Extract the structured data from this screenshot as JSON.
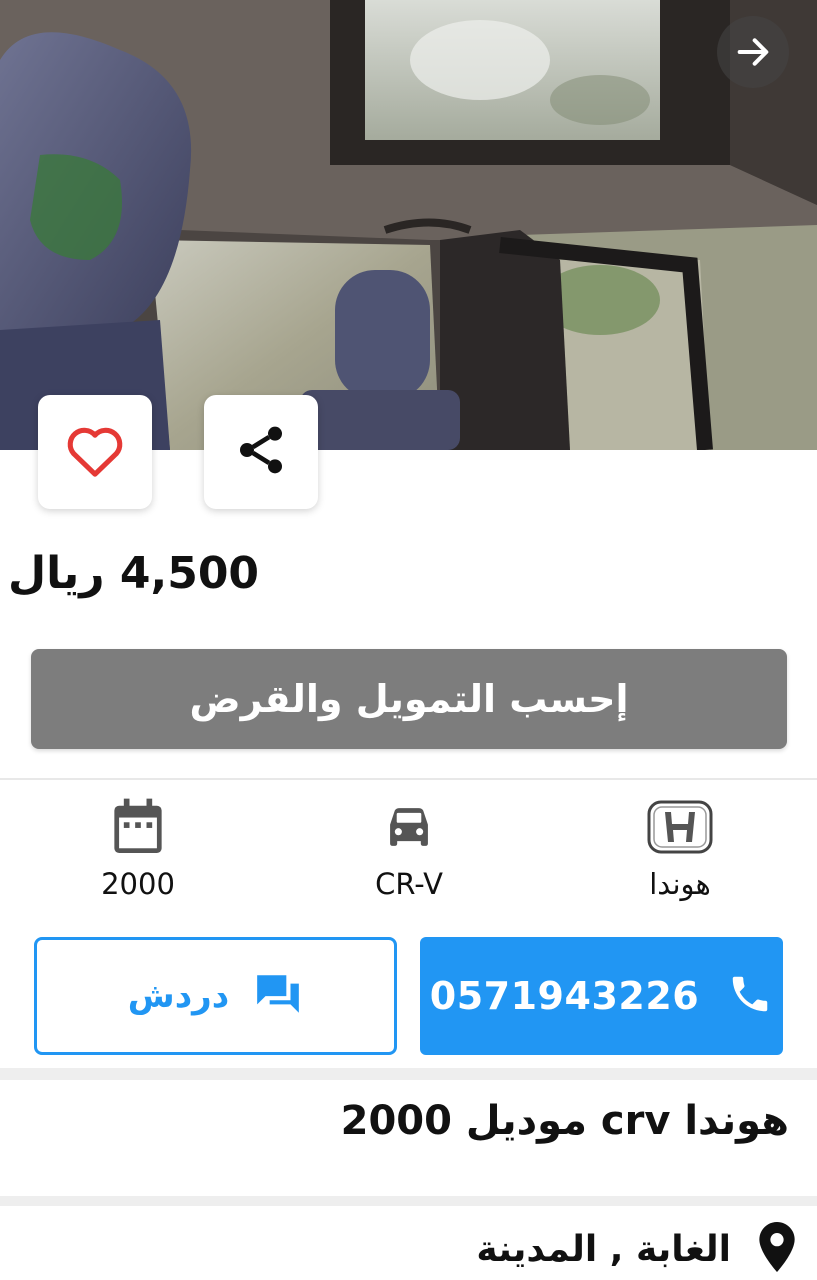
{
  "listing": {
    "price": "4,500 ريال",
    "finance_button_label": "إحسب التمويل والقرض",
    "title": "هوندا crv موديل 2000",
    "location": "الغابة , المدينة"
  },
  "specs": {
    "brand": "هوندا",
    "model": "CR-V",
    "year": "2000"
  },
  "contact": {
    "phone": "0571943226",
    "chat_label": "دردش"
  },
  "icons": {
    "back": "arrow-right-icon",
    "favorite": "heart-outline-icon",
    "share": "share-icon",
    "brand": "honda-logo-icon",
    "model": "car-icon",
    "year": "calendar-icon",
    "phone": "phone-icon",
    "chat": "chat-icon",
    "location": "location-pin-icon"
  },
  "colors": {
    "accent": "#2196f3",
    "finance_button": "#7d7d7d",
    "favorite": "#e53935",
    "text": "#111111"
  }
}
